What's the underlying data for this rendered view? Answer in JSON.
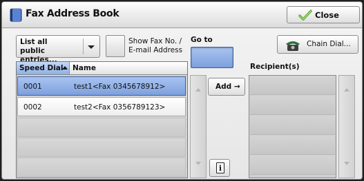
{
  "dialog": {
    "title": "Fax Address Book",
    "title_icon": "fax-address-book-icon",
    "close_label": "Close",
    "close_icon": "checkmark-icon"
  },
  "filter": {
    "selected": "List all public entries...",
    "line1": "List all",
    "line2": "public entries..."
  },
  "show_fax": {
    "line1": "Show Fax No. /",
    "line2": "E-mail Address",
    "checked": false
  },
  "goto": {
    "label": "Go to",
    "value": ""
  },
  "chain_dial": {
    "label": "Chain Dial...",
    "icon": "telephone-icon"
  },
  "list": {
    "columns": {
      "speed_dial": "Speed Dial",
      "name": "Name",
      "sort": "ascending"
    },
    "rows": [
      {
        "speed_dial": "0001",
        "name": "test1<Fax 0345678912>",
        "selected": true
      },
      {
        "speed_dial": "0002",
        "name": "test2<Fax 0356789123>",
        "selected": false
      }
    ]
  },
  "actions": {
    "add_label": "Add →"
  },
  "recipients": {
    "label": "Recipient(s)",
    "items": []
  },
  "colors": {
    "selection": "#8eb0e6",
    "panel": "#e9e9e9"
  }
}
